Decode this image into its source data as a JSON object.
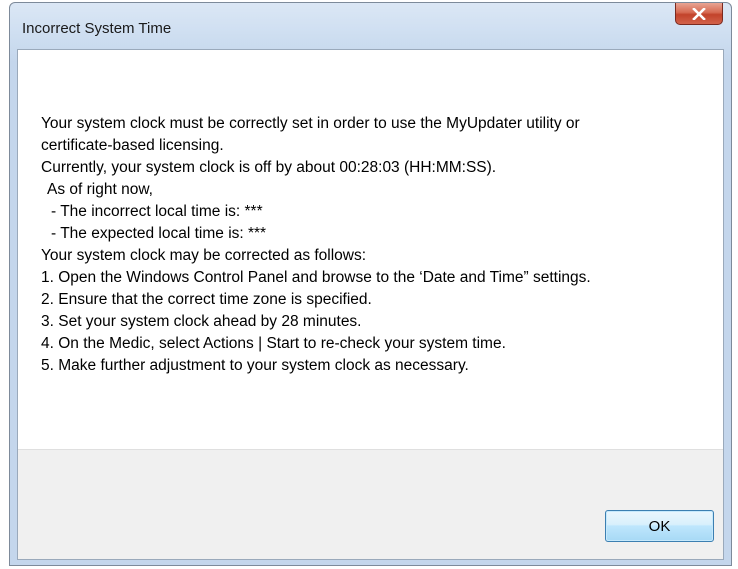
{
  "window": {
    "title": "Incorrect System Time",
    "close_icon": "close-icon"
  },
  "message": {
    "lines": [
      "Your system clock must be correctly set in order to use the MyUpdater utility or",
      "certificate-based licensing.",
      "Currently, your system clock is off by about 00:28:03 (HH:MM:SS).",
      "  As of right now,",
      "    - The incorrect local time is: ***",
      "    - The expected local time is: ***",
      "Your system clock may be corrected as follows:",
      "1. Open the Windows Control Panel and browse to the ‘Date and Time” settings.",
      "2. Ensure that the correct time zone is specified.",
      "3. Set your system clock ahead by 28 minutes.",
      "4. On the Medic, select Actions | Start to re-check your system time.",
      "5. Make further adjustment to your system clock as necessary."
    ]
  },
  "buttons": {
    "ok_label": "OK"
  },
  "colors": {
    "close_button": "#c2432b",
    "ok_button_border": "#3c7fb1",
    "footer_background": "#f0f0f0"
  }
}
